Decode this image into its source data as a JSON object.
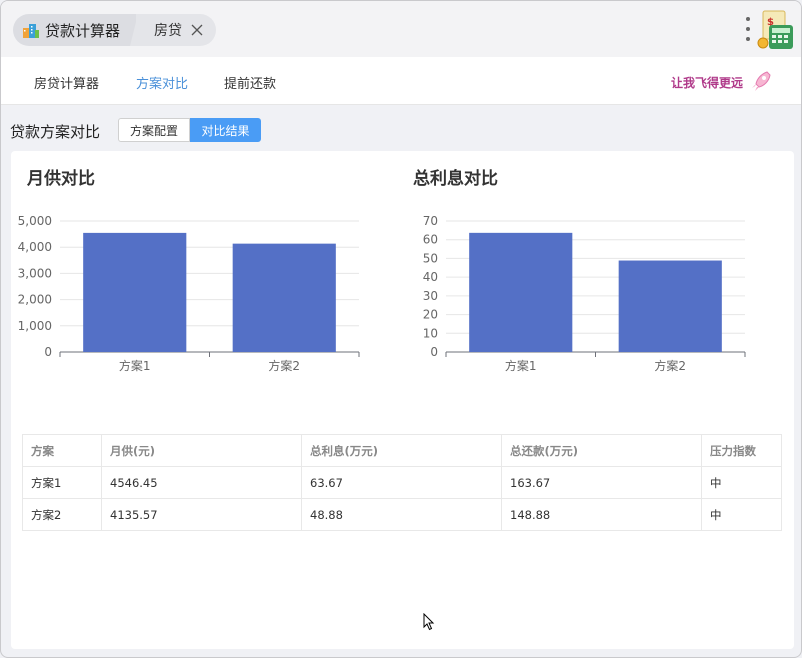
{
  "titlebar": {
    "tab_main_label": "贷款计算器",
    "tab_second_label": "房贷"
  },
  "nav": {
    "items": [
      {
        "label": "房贷计算器"
      },
      {
        "label": "方案对比"
      },
      {
        "label": "提前还款"
      }
    ],
    "slogan": "让我飞得更远"
  },
  "page": {
    "title": "贷款方案对比",
    "seg_config": "方案配置",
    "seg_result": "对比结果"
  },
  "chart_data": [
    {
      "type": "bar",
      "title": "月供对比",
      "categories": [
        "方案1",
        "方案2"
      ],
      "values": [
        4546.45,
        4135.57
      ],
      "ylim": [
        0,
        5000
      ],
      "yticks": [
        "0",
        "1,000",
        "2,000",
        "3,000",
        "4,000",
        "5,000"
      ],
      "grid": true,
      "color": "#5470c6"
    },
    {
      "type": "bar",
      "title": "总利息对比",
      "categories": [
        "方案1",
        "方案2"
      ],
      "values": [
        63.67,
        48.88
      ],
      "ylim": [
        0,
        70
      ],
      "yticks": [
        "0",
        "10",
        "20",
        "30",
        "40",
        "50",
        "60",
        "70"
      ],
      "grid": true,
      "color": "#5470c6"
    }
  ],
  "table": {
    "headers": [
      "方案",
      "月供(元)",
      "总利息(万元)",
      "总还款(万元)",
      "压力指数"
    ],
    "rows": [
      [
        "方案1",
        "4546.45",
        "63.67",
        "163.67",
        "中"
      ],
      [
        "方案2",
        "4135.57",
        "48.88",
        "148.88",
        "中"
      ]
    ]
  }
}
